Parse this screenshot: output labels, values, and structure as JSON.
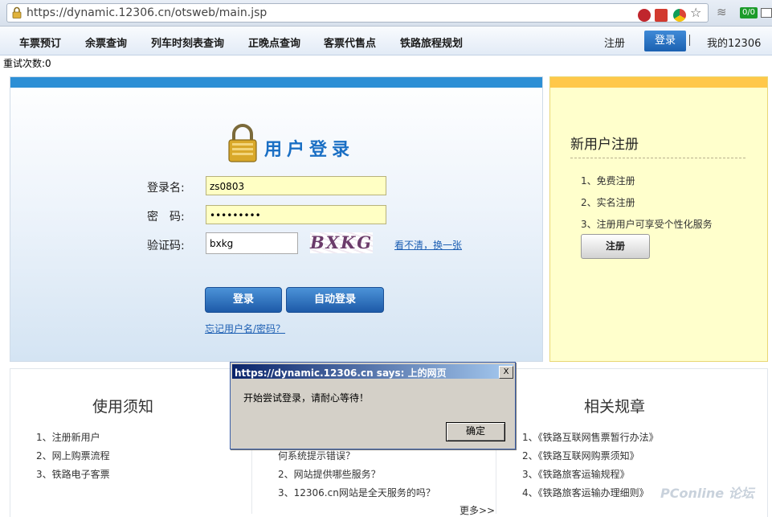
{
  "browser": {
    "url": "https://dynamic.12306.cn/otsweb/main.jsp",
    "extension_badge": "0/0"
  },
  "nav": {
    "items": [
      "车票预订",
      "余票查询",
      "列车时刻表查询",
      "正晚点查询",
      "客票代售点",
      "铁路旅程规划"
    ],
    "register": "注册",
    "login": "登录",
    "my12306": "我的12306"
  },
  "retry_count_label": "重试次数:0",
  "login": {
    "title": "用户登录",
    "username_label": "登录名:",
    "username_value": "zs0803",
    "password_label": "密　码:",
    "password_value": "•••••••••",
    "captcha_label": "验证码:",
    "captcha_value": "bxkg",
    "captcha_image_text": "BXKG",
    "refresh_link": "看不清，换一张",
    "login_button": "登录",
    "auto_login_button": "自动登录",
    "forgot_link": "忘记用户名/密码？"
  },
  "register_panel": {
    "title": "新用户注册",
    "items": [
      "1、免费注册",
      "2、实名注册",
      "3、注册用户可享受个性化服务"
    ],
    "button": "注册"
  },
  "usage": {
    "title": "使用须知",
    "items": [
      "1、注册新用户",
      "2、网上购票流程",
      "3、铁路电子客票"
    ]
  },
  "faq": {
    "items": [
      "何系统提示错误？",
      "2、网站提供哪些服务？",
      "3、12306.cn网站是全天服务的吗？"
    ],
    "more": "更多>>"
  },
  "regulations": {
    "title": "相关规章",
    "items": [
      "1、《铁路互联网售票暂行办法》",
      "2、《铁路互联网购票须知》",
      "3、《铁路旅客运输规程》",
      "4、《铁路旅客运输办理细则》"
    ]
  },
  "dialog": {
    "title": "https://dynamic.12306.cn says: 上的网页",
    "message": "开始尝试登录，请耐心等待！",
    "ok": "确定",
    "close": "X"
  },
  "watermark": "PConline 论坛",
  "colors": {
    "nav_login_bg": "#1b61b1",
    "login_topbar": "#2d8fd5",
    "register_topbar": "#ffc84a",
    "register_bg": "#ffffcc",
    "input_bg": "#ffffc4",
    "link": "#1d5fb3",
    "dialog_title": "#0a246a"
  }
}
